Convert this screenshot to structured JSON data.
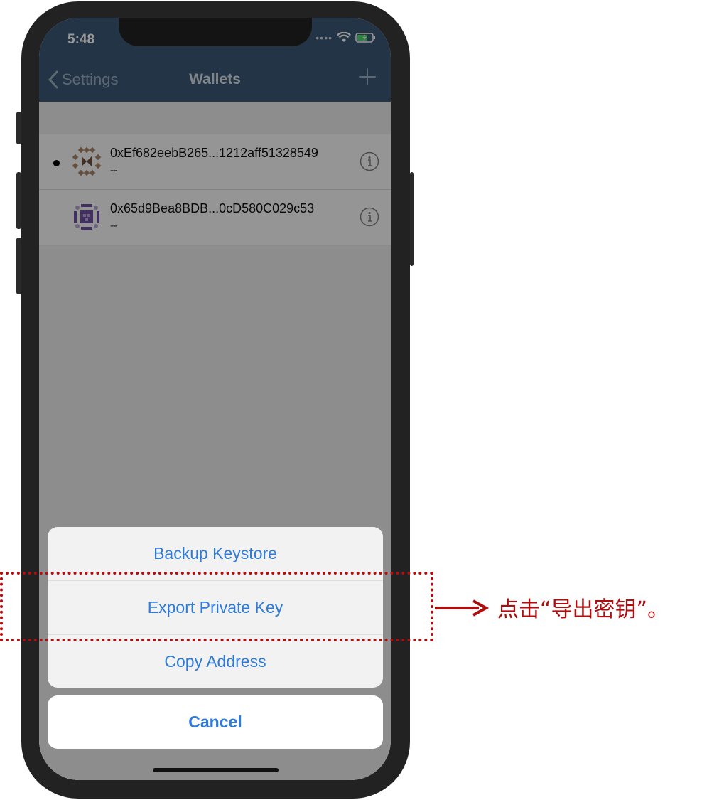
{
  "status_bar": {
    "time": "5:48"
  },
  "nav": {
    "back_label": "Settings",
    "title": "Wallets"
  },
  "wallets": [
    {
      "address": "0xEf682eebB265...1212aff51328549",
      "balance": "--",
      "active": true
    },
    {
      "address": "0x65d9Bea8BDB...0cD580C029c53",
      "balance": "--",
      "active": false
    }
  ],
  "action_sheet": {
    "options": [
      "Backup Keystore",
      "Export Private Key",
      "Copy Address"
    ],
    "cancel_label": "Cancel"
  },
  "annotation": {
    "text": "点击“导出密钥”。"
  },
  "colors": {
    "header": "#3b5775",
    "accent_blue": "#2f7bd9",
    "annotation_red": "#b00e0e"
  }
}
